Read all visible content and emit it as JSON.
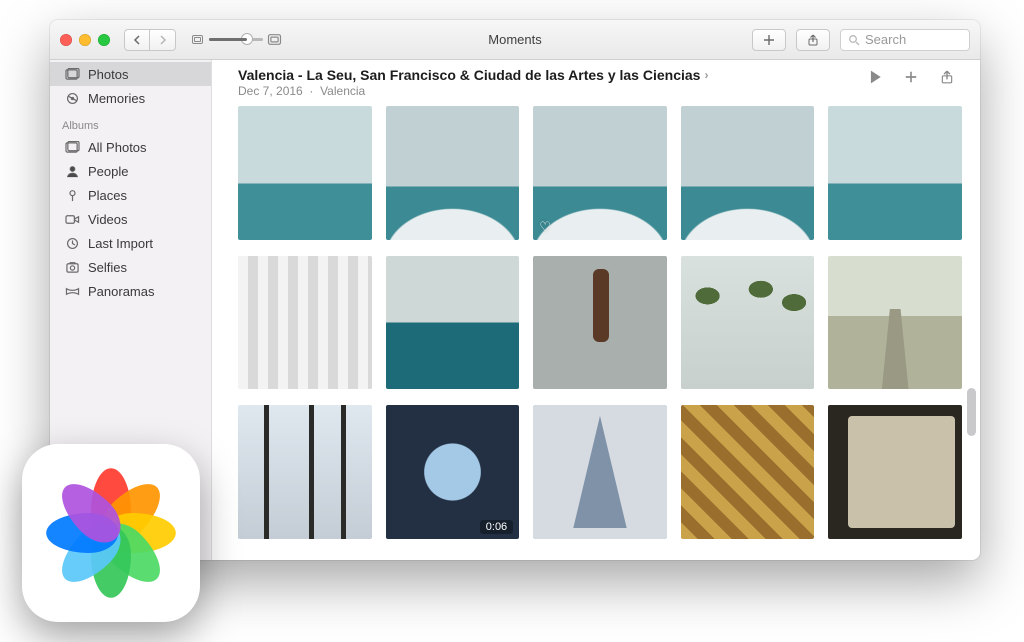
{
  "window": {
    "title": "Moments"
  },
  "toolbar": {
    "search_placeholder": "Search"
  },
  "sidebar": {
    "library": [
      {
        "key": "photos",
        "label": "Photos",
        "icon": "photos-icon",
        "selected": true
      },
      {
        "key": "memories",
        "label": "Memories",
        "icon": "memories-icon",
        "selected": false
      }
    ],
    "albums_heading": "Albums",
    "albums": [
      {
        "key": "all",
        "label": "All Photos",
        "icon": "all-photos-icon"
      },
      {
        "key": "people",
        "label": "People",
        "icon": "people-icon"
      },
      {
        "key": "places",
        "label": "Places",
        "icon": "places-icon"
      },
      {
        "key": "videos",
        "label": "Videos",
        "icon": "videos-icon"
      },
      {
        "key": "lastimport",
        "label": "Last Import",
        "icon": "last-import-icon"
      },
      {
        "key": "selfies",
        "label": "Selfies",
        "icon": "selfies-icon"
      },
      {
        "key": "panoramas",
        "label": "Panoramas",
        "icon": "panoramas-icon"
      }
    ]
  },
  "moment": {
    "title": "Valencia - La Seu, San Francisco & Ciudad de las Artes y las Ciencias",
    "date": "Dec 7, 2016",
    "separator": "·",
    "location": "Valencia"
  },
  "thumbs": [
    {
      "kind": "sky"
    },
    {
      "kind": "dome"
    },
    {
      "kind": "dome",
      "favorite": true
    },
    {
      "kind": "dome"
    },
    {
      "kind": "sky"
    },
    {
      "kind": "arches"
    },
    {
      "kind": "pool"
    },
    {
      "kind": "swing"
    },
    {
      "kind": "palms"
    },
    {
      "kind": "walk"
    },
    {
      "kind": "palmsky"
    },
    {
      "kind": "glass",
      "video_duration": "0:06"
    },
    {
      "kind": "wedge"
    },
    {
      "kind": "tiles"
    },
    {
      "kind": "stone"
    }
  ],
  "appicon": {
    "name": "Photos",
    "petal_colors": [
      "#ff3b30",
      "#ff9500",
      "#ffcc00",
      "#4cd964",
      "#34c759",
      "#5ac8fa",
      "#007aff",
      "#af52de"
    ]
  }
}
